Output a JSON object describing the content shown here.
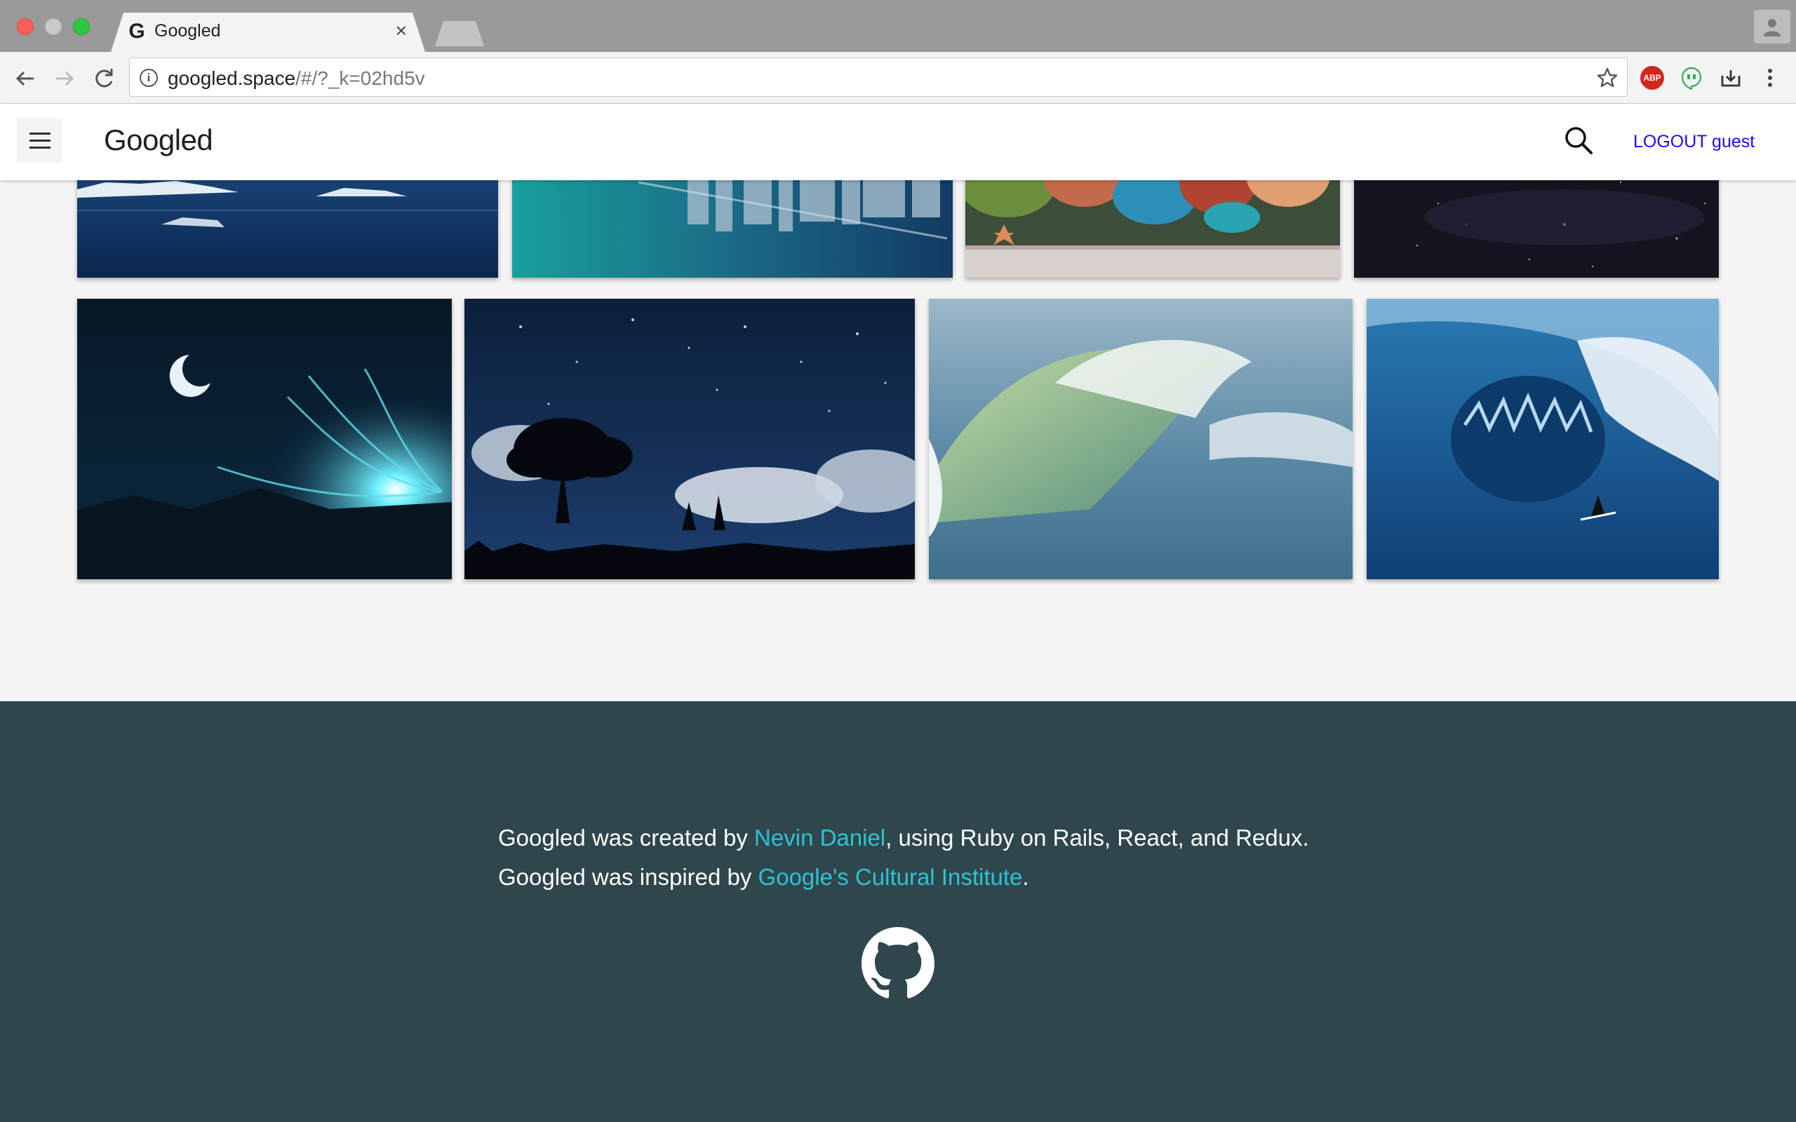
{
  "browser": {
    "tab_title": "Googled",
    "tab_favicon": "G",
    "url_host": "googled.space",
    "url_rest": "/#/?_k=02hd5v",
    "extensions": {
      "abp_label": "ABP"
    }
  },
  "header": {
    "logo": "Googled",
    "logout_label": "LOGOUT guest"
  },
  "gallery": {
    "tiles": [
      "iceberg-ocean-image",
      "futuristic-city-water-image",
      "coral-reef-aquarium-image",
      "starry-night-sky-image",
      "crescent-moon-aurora-image",
      "tree-silhouette-dancers-image",
      "green-ocean-wave-image",
      "shark-wave-surfer-image"
    ]
  },
  "footer": {
    "line1_prefix": "Googled was created by ",
    "line1_link": "Nevin Daniel",
    "line1_suffix": ", using Ruby on Rails, React, and Redux.",
    "line2_prefix": "Googled was inspired by ",
    "line2_link": "Google's Cultural Institute",
    "line2_suffix": ".",
    "link_color": "#2dc3d3",
    "background": "#2e464c"
  }
}
